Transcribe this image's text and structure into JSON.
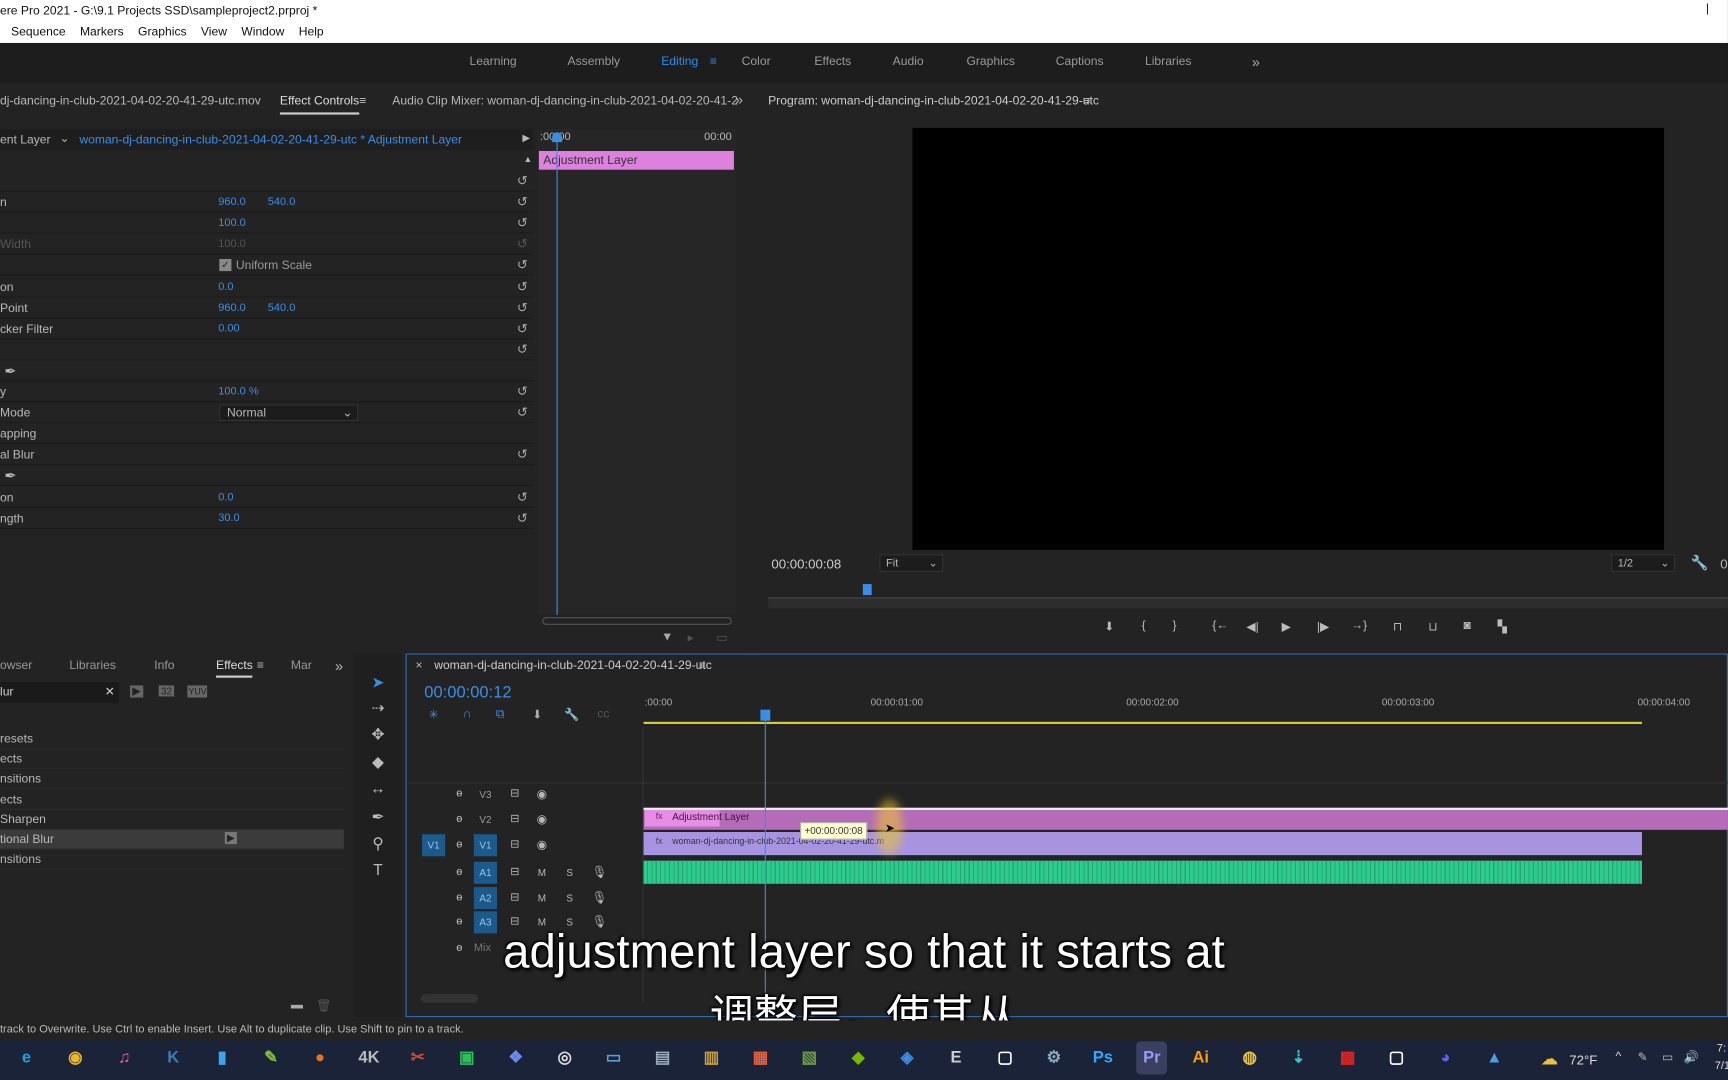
{
  "window": {
    "title": "ere Pro 2021 - G:\\9.1 Projects SSD\\sampleproject2.prproj *",
    "close": "|"
  },
  "menu": [
    "Sequence",
    "Markers",
    "Graphics",
    "View",
    "Window",
    "Help"
  ],
  "workspaces": {
    "tabs": [
      "Learning",
      "Assembly",
      "Editing",
      "Color",
      "Effects",
      "Audio",
      "Graphics",
      "Captions",
      "Libraries"
    ],
    "active": "Editing",
    "more": "»"
  },
  "effect_controls": {
    "tabs": {
      "source": "dj-dancing-in-club-2021-04-02-20-41-29-utc.mov",
      "active": "Effect Controls",
      "mixer": "Audio Clip Mixer: woman-dj-dancing-in-club-2021-04-02-20-41-2"
    },
    "master": "ent Layer",
    "clip": "woman-dj-dancing-in-club-2021-04-02-20-41-29-utc * Adjustment Layer",
    "mini_timeline": {
      "start": ":00:00",
      "end": "00:00",
      "clip": "Adjustment Layer"
    },
    "rows": [
      {
        "label": "",
        "v1": "",
        "v2": "",
        "reset": true
      },
      {
        "label": "n",
        "v1": "960.0",
        "v2": "540.0",
        "reset": true
      },
      {
        "label": "",
        "v1": "100.0",
        "v2": "",
        "reset": true
      },
      {
        "label": "Width",
        "v1": "100.0",
        "v2": "",
        "reset": true,
        "dim": true
      },
      {
        "label": "",
        "check": "Uniform Scale",
        "reset": true
      },
      {
        "label": "on",
        "v1": "0.0",
        "v2": "",
        "reset": true
      },
      {
        "label": " Point",
        "v1": "960.0",
        "v2": "540.0",
        "reset": true
      },
      {
        "label": "cker Filter",
        "v1": "0.00",
        "v2": "",
        "reset": true
      },
      {
        "label": "",
        "v1": "",
        "v2": "",
        "reset": true
      },
      {
        "label": "",
        "pen": true
      },
      {
        "label": "y",
        "v1": "100.0 %",
        "v2": "",
        "reset": true
      },
      {
        "label": "Mode",
        "select": "Normal",
        "reset": true
      },
      {
        "label": "apping"
      },
      {
        "label": "al Blur",
        "reset": true
      },
      {
        "label": "",
        "pen": true
      },
      {
        "label": "on",
        "v1": "0.0",
        "v2": "",
        "reset": true
      },
      {
        "label": "ngth",
        "v1": "30.0",
        "v2": "",
        "reset": true
      }
    ]
  },
  "program": {
    "title": "Program: woman-dj-dancing-in-club-2021-04-02-20-41-29-utc",
    "timecode": "00:00:00:08",
    "fit": "Fit",
    "resolution": "1/2",
    "right_tc": "0"
  },
  "effects_panel": {
    "tabs": [
      "owser",
      "Libraries",
      "Info",
      "Effects",
      "Mar"
    ],
    "active": "Effects",
    "search": "lur",
    "items": [
      "resets",
      "ects",
      "nsitions",
      "ects",
      "Sharpen",
      "tional Blur",
      "nsitions"
    ],
    "selected": 5
  },
  "timeline": {
    "title": "woman-dj-dancing-in-club-2021-04-02-20-41-29-utc",
    "timecode": "00:00:00:12",
    "ruler": [
      ":00:00",
      "00:00:01:00",
      "00:00:02:00",
      "00:00:03:00",
      "00:00:04:00"
    ],
    "video_tracks": [
      "V3",
      "V2",
      "V1"
    ],
    "audio_tracks": [
      "A1",
      "A2",
      "A3"
    ],
    "mix": "Mix",
    "source_patch": "V1",
    "clips": {
      "adjustment": "Adjustment Layer",
      "video": "woman-dj-dancing-in-club-2021-04-02-20-41-29-utc.m",
      "fx": "fx"
    },
    "tooltip": "+00:00:00:08",
    "m": "M",
    "s": "S"
  },
  "status": "track to Overwrite. Use Ctrl to enable Insert. Use Alt to duplicate clip. Use Shift to pin to a track.",
  "subtitles": {
    "en": "adjustment layer so that it starts at",
    "zh": "调整层，使其从"
  },
  "taskbar": {
    "apps": [
      {
        "name": "edge",
        "g": "e",
        "c": "#1fa0e0"
      },
      {
        "name": "chrome",
        "g": "◉",
        "c": "#e8b72c"
      },
      {
        "name": "itunes",
        "g": "♫",
        "c": "#e05fb5"
      },
      {
        "name": "kindle",
        "g": "K",
        "c": "#3b7bb6"
      },
      {
        "name": "files",
        "g": "▮",
        "c": "#3da6ea"
      },
      {
        "name": "notepad",
        "g": "✎",
        "c": "#7fbf3f"
      },
      {
        "name": "app",
        "g": "●",
        "c": "#e8731f"
      },
      {
        "name": "4k",
        "g": "4K",
        "c": "#bbb"
      },
      {
        "name": "snip",
        "g": "✂",
        "c": "#d9482c"
      },
      {
        "name": "screen",
        "g": "▣",
        "c": "#2dbf5a"
      },
      {
        "name": "app2",
        "g": "❖",
        "c": "#6a8cf0"
      },
      {
        "name": "obs",
        "g": "◎",
        "c": "#ddd"
      },
      {
        "name": "monitor",
        "g": "▭",
        "c": "#5a9fd6"
      },
      {
        "name": "perf",
        "g": "▤",
        "c": "#9ab"
      },
      {
        "name": "library",
        "g": "▥",
        "c": "#c8a040"
      },
      {
        "name": "app3",
        "g": "▦",
        "c": "#e06040"
      },
      {
        "name": "photos",
        "g": "▧",
        "c": "#6c9b4c"
      },
      {
        "name": "nvidia",
        "g": "◆",
        "c": "#76b900"
      },
      {
        "name": "app4",
        "g": "◈",
        "c": "#3c8ee8"
      },
      {
        "name": "epic",
        "g": "E",
        "c": "#ccc"
      },
      {
        "name": "oculus",
        "g": "▢",
        "c": "#fff"
      },
      {
        "name": "steam",
        "g": "⚙",
        "c": "#8ab"
      },
      {
        "name": "photoshop",
        "g": "Ps",
        "c": "#31a8ff"
      },
      {
        "name": "premiere",
        "g": "Pr",
        "c": "#9999ff"
      },
      {
        "name": "illustrator",
        "g": "Ai",
        "c": "#ff9a00"
      },
      {
        "name": "davinci",
        "g": "◍",
        "c": "#e5c34a"
      },
      {
        "name": "app5",
        "g": "⇣",
        "c": "#3cc"
      },
      {
        "name": "app6",
        "g": "▩",
        "c": "#d22"
      },
      {
        "name": "oculus2",
        "g": "▢",
        "c": "#fff"
      },
      {
        "name": "discord",
        "g": "◕",
        "c": "#5865f2"
      },
      {
        "name": "gallery",
        "g": "▲",
        "c": "#4aa0e0"
      }
    ],
    "weather": "72°F",
    "time": "7:",
    "date": "7/1"
  },
  "colors": {
    "accent": "#2d8ceb",
    "adjustment_clip": "#d98ad9",
    "video_clip": "#a794e0",
    "audio_clip": "#2fcb8e",
    "work_area": "#d6c93a"
  }
}
